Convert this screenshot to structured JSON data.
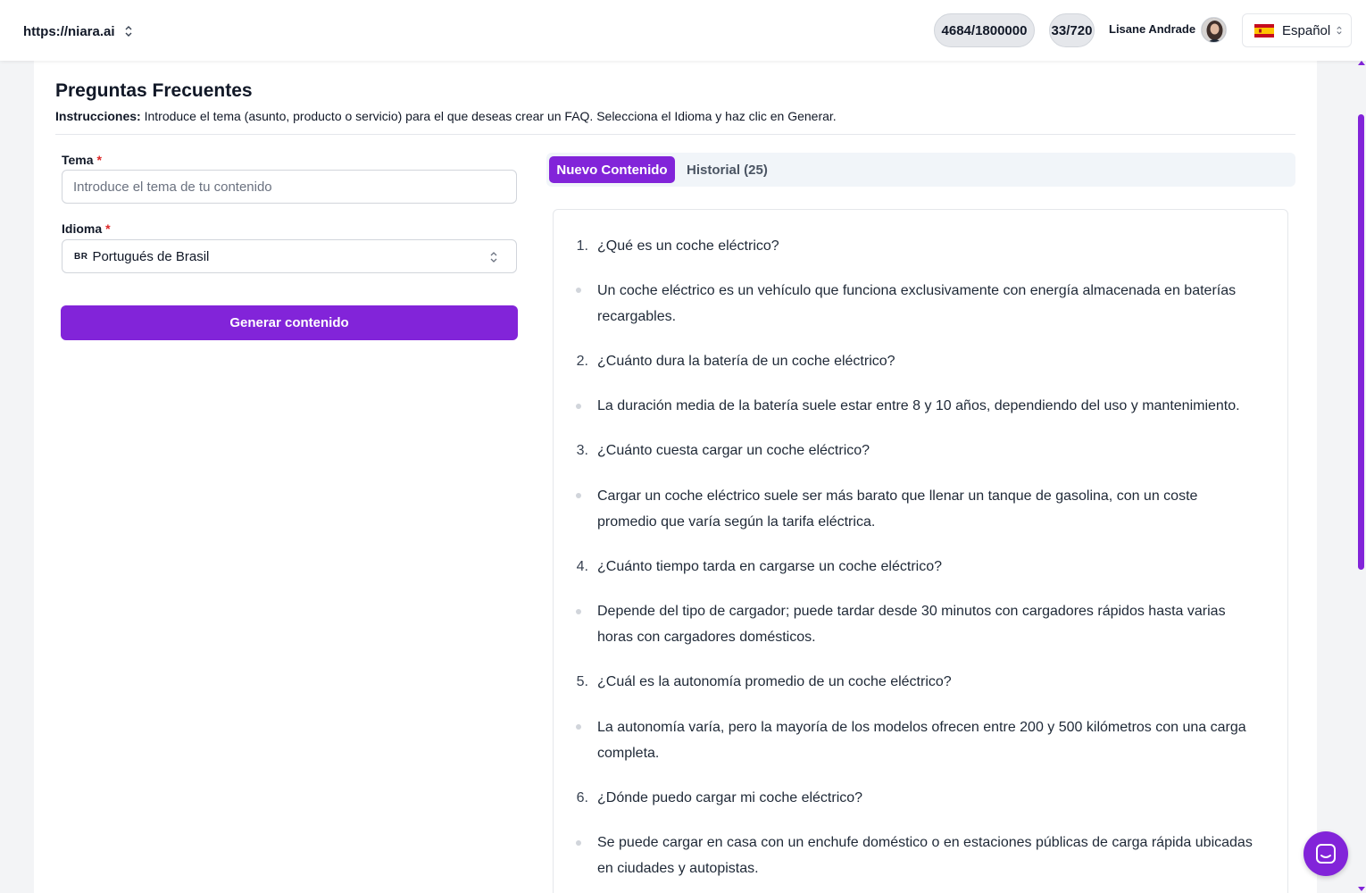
{
  "topbar": {
    "site": "https://niara.ai",
    "words_counter": "4684/1800000",
    "images_counter": "33/720",
    "user_name": "Lisane Andrade",
    "language": "Español"
  },
  "page": {
    "title": "Preguntas Frecuentes",
    "instructions_label": "Instrucciones:",
    "instructions_text": " Introduce el tema (asunto, producto o servicio) para el que deseas crear un FAQ. Selecciona el Idioma y haz clic en Generar."
  },
  "form": {
    "topic_label": "Tema",
    "topic_placeholder": "Introduce el tema de tu contenido",
    "topic_value": "",
    "language_label": "Idioma",
    "required_mark": "*",
    "language_code": "BR",
    "language_value": "Portugués de Brasil",
    "generate_label": "Generar contenido"
  },
  "tabs": {
    "new_content": "Nuevo Contenido",
    "history": "Historial (25)"
  },
  "faq": [
    {
      "num": "1.",
      "question": "¿Qué es un coche eléctrico?",
      "answer_lines": [
        "Un coche eléctrico es un vehículo que funciona exclusivamente con energía almacenada en baterías",
        "recargables."
      ]
    },
    {
      "num": "2.",
      "question": "¿Cuánto dura la batería de un coche eléctrico?",
      "answer_lines": [
        "La duración media de la batería suele estar entre 8 y 10 años, dependiendo del uso y mantenimiento."
      ]
    },
    {
      "num": "3.",
      "question": "¿Cuánto cuesta cargar un coche eléctrico?",
      "answer_lines": [
        "Cargar un coche eléctrico suele ser más barato que llenar un tanque de gasolina, con un coste",
        "promedio que varía según la tarifa eléctrica."
      ]
    },
    {
      "num": "4.",
      "question": "¿Cuánto tiempo tarda en cargarse un coche eléctrico?",
      "answer_lines": [
        "Depende del tipo de cargador; puede tardar desde 30 minutos con cargadores rápidos hasta varias",
        "horas con cargadores domésticos."
      ]
    },
    {
      "num": "5.",
      "question": "¿Cuál es la autonomía promedio de un coche eléctrico?",
      "answer_lines": [
        "La autonomía varía, pero la mayoría de los modelos ofrecen entre 200 y 500 kilómetros con una carga",
        "completa."
      ]
    },
    {
      "num": "6.",
      "question": "¿Dónde puedo cargar mi coche eléctrico?",
      "answer_lines": [
        "Se puede cargar en casa con un enchufe doméstico o en estaciones públicas de carga rápida ubicadas",
        "en ciudades y autopistas."
      ]
    }
  ],
  "icons": {
    "site_chevron": "chevrons-up-down-icon",
    "language_flag": "spain-flag-icon",
    "chat": "chat-icon"
  },
  "colors": {
    "accent": "#8224d9",
    "required": "#dc2626"
  }
}
